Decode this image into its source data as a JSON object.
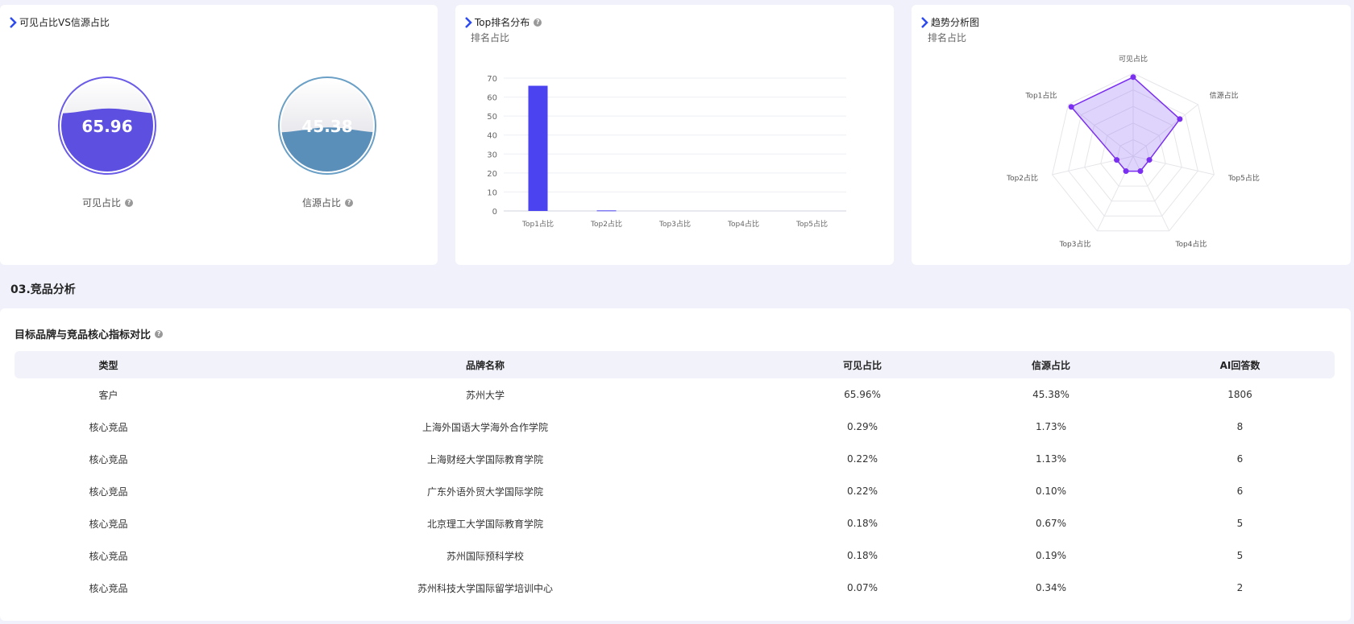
{
  "panel1": {
    "title": "可见占比VS信源占比",
    "gauge1": {
      "value": "65.96",
      "label": "可见占比",
      "level": 65.96,
      "color": "#5d4fe0",
      "ring": "#6a5ce6"
    },
    "gauge2": {
      "value": "45.38",
      "label": "信源占比",
      "level": 45.38,
      "color": "#5a8fba",
      "ring": "#6a9fc6"
    }
  },
  "panel2": {
    "title": "Top排名分布",
    "subtitle": "排名占比",
    "chart_data": {
      "type": "bar",
      "categories": [
        "Top1占比",
        "Top2占比",
        "Top3占比",
        "Top4占比",
        "Top5占比"
      ],
      "values": [
        65.96,
        0.29,
        0,
        0,
        0
      ],
      "ylim": [
        0,
        70
      ],
      "yticks": [
        0,
        10,
        20,
        30,
        40,
        50,
        60,
        70
      ],
      "grid": true,
      "color": "#4b42f0"
    }
  },
  "panel3": {
    "title": "趋势分析图",
    "subtitle": "排名占比",
    "chart_data": {
      "type": "radar",
      "axes": [
        "可见占比",
        "信源占比",
        "Top5占比",
        "Top4占比",
        "Top3占比",
        "Top2占比",
        "Top1占比"
      ],
      "values": [
        65.96,
        45.38,
        0,
        0,
        0,
        0.29,
        65.96
      ],
      "max": 70,
      "color": "#7b2ff0"
    }
  },
  "section": {
    "title": "03.竞品分析"
  },
  "table": {
    "title": "目标品牌与竞品核心指标对比",
    "headers": [
      "类型",
      "品牌名称",
      "可见占比",
      "信源占比",
      "AI回答数"
    ],
    "rows": [
      [
        "客户",
        "苏州大学",
        "65.96%",
        "45.38%",
        "1806"
      ],
      [
        "核心竞品",
        "上海外国语大学海外合作学院",
        "0.29%",
        "1.73%",
        "8"
      ],
      [
        "核心竞品",
        "上海财经大学国际教育学院",
        "0.22%",
        "1.13%",
        "6"
      ],
      [
        "核心竞品",
        "广东外语外贸大学国际学院",
        "0.22%",
        "0.10%",
        "6"
      ],
      [
        "核心竞品",
        "北京理工大学国际教育学院",
        "0.18%",
        "0.67%",
        "5"
      ],
      [
        "核心竞品",
        "苏州国际预科学校",
        "0.18%",
        "0.19%",
        "5"
      ],
      [
        "核心竞品",
        "苏州科技大学国际留学培训中心",
        "0.07%",
        "0.34%",
        "2"
      ]
    ]
  }
}
